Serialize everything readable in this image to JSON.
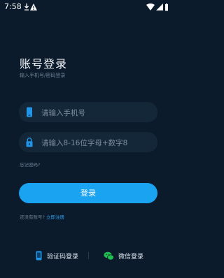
{
  "status_bar": {
    "time": "7:58",
    "left_icons": [
      "download-icon",
      "alert-icon"
    ],
    "right_icons": [
      "wifi-icon",
      "signal-icon",
      "battery-icon"
    ]
  },
  "login": {
    "title": "账号登录",
    "subtitle": "输入手机号/密码登录",
    "phone_placeholder": "请输入手机号",
    "password_placeholder": "请输入8-16位字母+数字8",
    "forgot_password": "忘记密码?",
    "login_button": "登录",
    "register_prompt": "还没有账号?",
    "register_link": "立即注册"
  },
  "alt_login": {
    "sms_label": "验证码登录",
    "wechat_label": "微信登录"
  },
  "colors": {
    "background": "#0c1b2c",
    "field_background": "#132739",
    "accent": "#1aa3f0",
    "wechat": "#1fbf4f"
  }
}
